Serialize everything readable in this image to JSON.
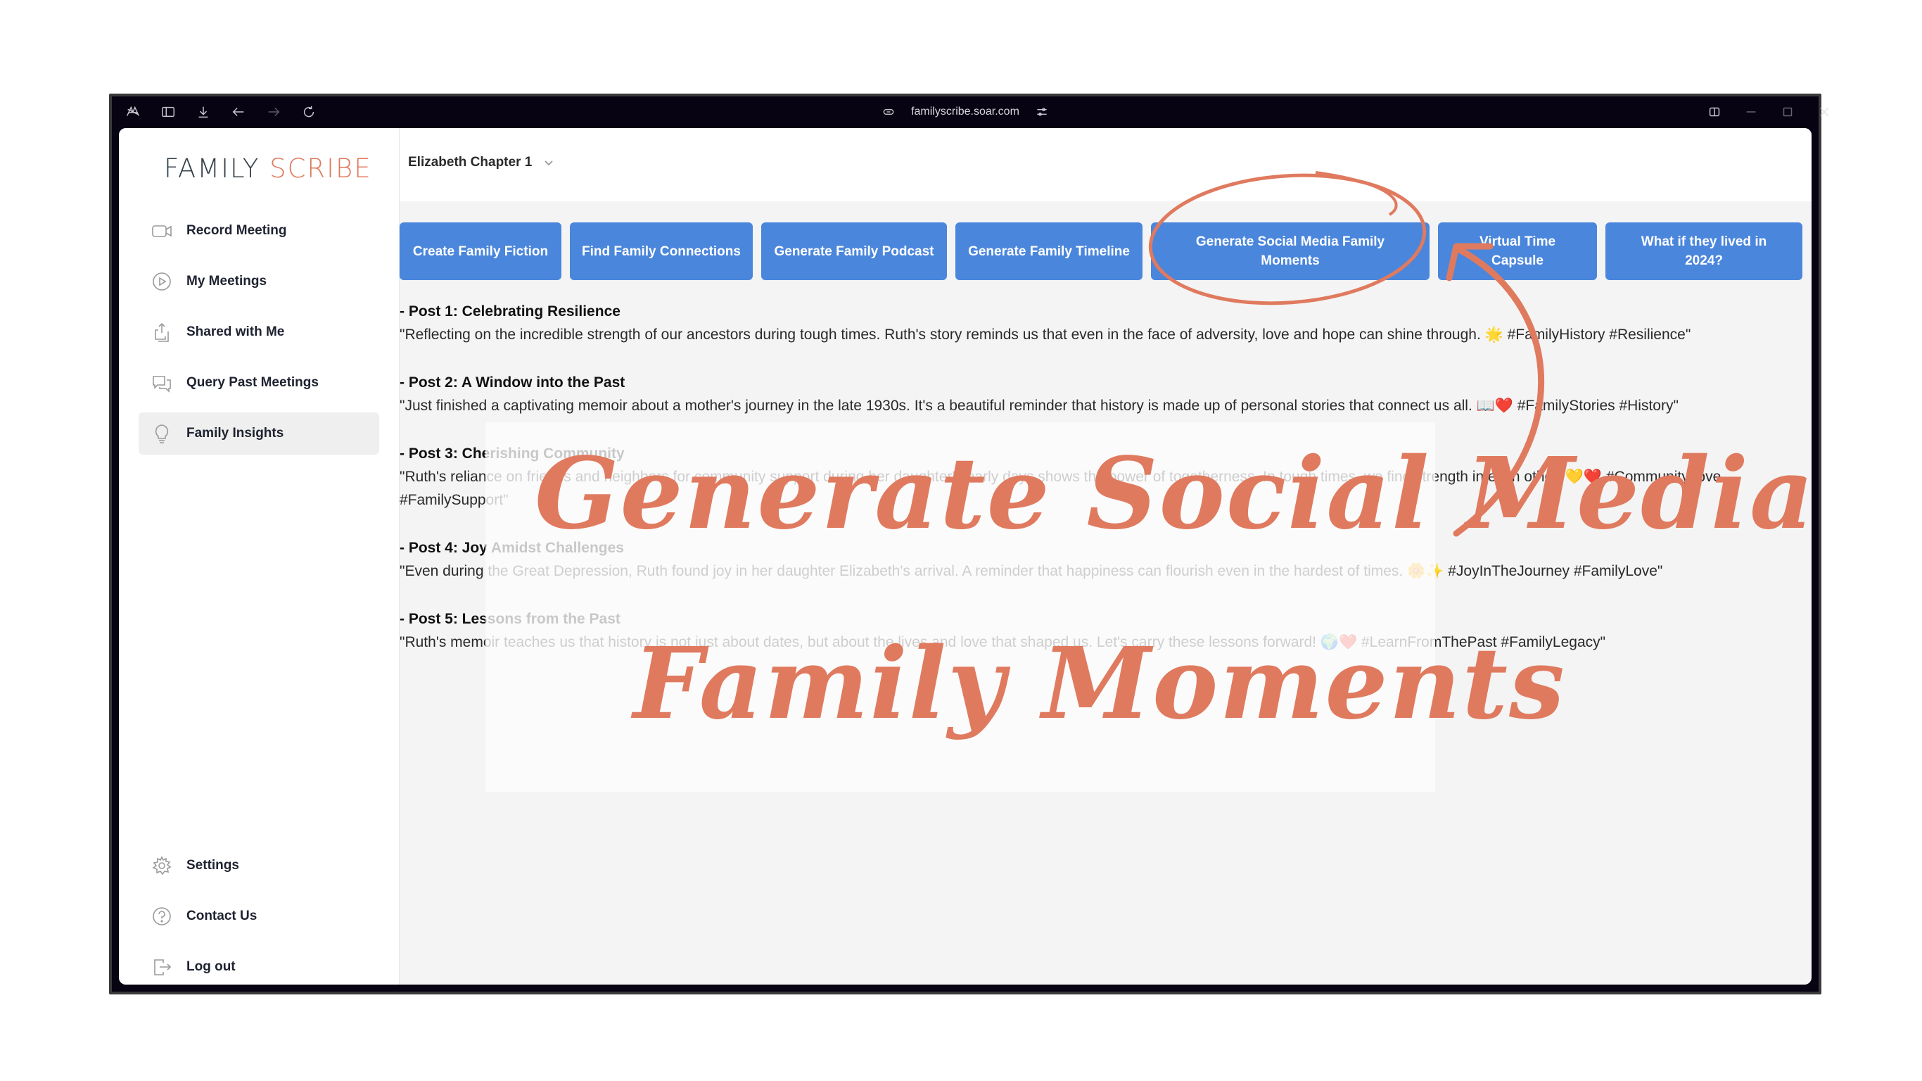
{
  "browser": {
    "url": "familyscribe.soar.com",
    "left_icons": [
      "app-logo-icon",
      "sidebar-toggle-icon",
      "download-icon",
      "back-icon",
      "forward-icon",
      "reload-icon"
    ],
    "right_icons": [
      "split-view-icon",
      "minimize-icon",
      "maximize-icon",
      "close-icon"
    ]
  },
  "logo": {
    "part1": "FAMILY",
    "part2": "SCRIBE",
    "accent_color": "#e07a5f"
  },
  "sidebar": {
    "items": [
      {
        "label": "Record Meeting",
        "icon": "video-camera-icon"
      },
      {
        "label": "My Meetings",
        "icon": "play-circle-icon"
      },
      {
        "label": "Shared with Me",
        "icon": "share-icon"
      },
      {
        "label": "Query Past Meetings",
        "icon": "chat-bubbles-icon"
      },
      {
        "label": "Family Insights",
        "icon": "lightbulb-icon",
        "active": true
      }
    ],
    "bottom_items": [
      {
        "label": "Settings",
        "icon": "gear-icon"
      },
      {
        "label": "Contact Us",
        "icon": "help-circle-icon"
      },
      {
        "label": "Log out",
        "icon": "logout-icon"
      }
    ]
  },
  "header": {
    "chapter_select": "Elizabeth Chapter 1"
  },
  "actions": {
    "button_color": "#4a86dc",
    "buttons": [
      "Create Family Fiction",
      "Find Family Connections",
      "Generate Family Podcast",
      "Generate Family Timeline",
      "Generate Social Media Family Moments",
      "Virtual Time Capsule",
      "What if they lived in 2024?"
    ]
  },
  "posts": [
    {
      "title": "- Post 1: Celebrating Resilience",
      "body": "\"Reflecting on the incredible strength of our ancestors during tough times. Ruth's story reminds us that even in the face of adversity, love and hope can shine through. 🌟 #FamilyHistory #Resilience\""
    },
    {
      "title": "- Post 2: A Window into the Past",
      "body": "\"Just finished a captivating memoir about a mother's journey in the late 1930s. It's a beautiful reminder that history is made up of personal stories that connect us all. 📖❤️ #FamilyStories #History\""
    },
    {
      "title": "- Post 3: Cherishing Community",
      "body": "\"Ruth's reliance on friends and neighbors for community support during her daughter's early days shows the power of togetherness. In tough times, we find strength in each other. 💛❤️ #CommunityLove #FamilySupport\""
    },
    {
      "title": "- Post 4: Joy Amidst Challenges",
      "body": "\"Even during the Great Depression, Ruth found joy in her daughter Elizabeth's arrival. A reminder that happiness can flourish even in the hardest of times. 🌼✨ #JoyInTheJourney #FamilyLove\""
    },
    {
      "title": "- Post 5: Lessons from the Past",
      "body": "\"Ruth's memoir teaches us that history is not just about dates, but about the lives and love that shaped us. Let's carry these lessons forward! 🌍❤️ #LearnFromThePast #FamilyLegacy\""
    }
  ],
  "annotation": {
    "line1": "Generate Social Media",
    "line2": "Family Moments",
    "color": "#e07a5f"
  }
}
